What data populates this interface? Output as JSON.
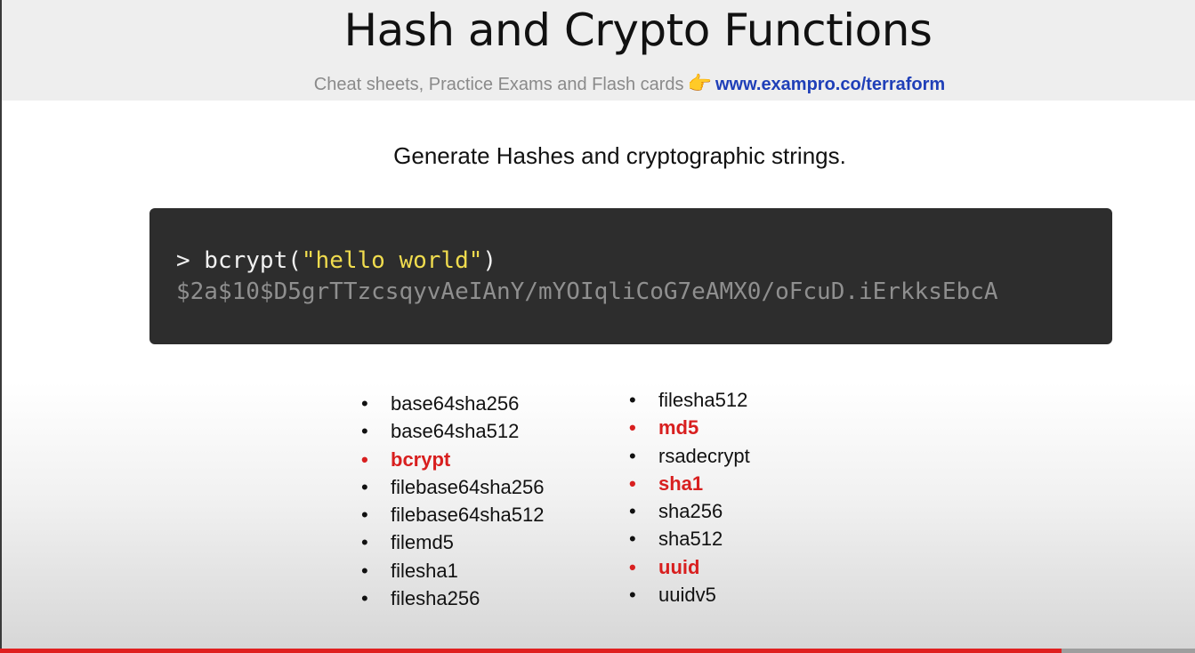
{
  "slide": {
    "title": "Hash and Crypto Functions",
    "promo_text": "Cheat sheets, Practice Exams and Flash cards",
    "promo_icon": "pointing-hand-icon",
    "promo_hand_glyph": "👉",
    "promo_link": "www.exampro.co/terraform",
    "subtitle": "Generate Hashes and cryptographic strings."
  },
  "code": {
    "prompt_prefix": "> bcrypt(",
    "prompt_arg": "\"hello world\"",
    "prompt_suffix": ")",
    "output": "$2a$10$D5grTTzcsqyvAeIAnY/mYOIqliCoG7eAMX0/oFcuD.iErkksEbcA"
  },
  "functions_left": [
    {
      "name": "base64sha256",
      "highlight": false
    },
    {
      "name": "base64sha512",
      "highlight": false
    },
    {
      "name": "bcrypt",
      "highlight": true
    },
    {
      "name": "filebase64sha256",
      "highlight": false
    },
    {
      "name": "filebase64sha512",
      "highlight": false
    },
    {
      "name": "filemd5",
      "highlight": false
    },
    {
      "name": "filesha1",
      "highlight": false
    },
    {
      "name": "filesha256",
      "highlight": false
    }
  ],
  "functions_right": [
    {
      "name": "filesha512",
      "highlight": false
    },
    {
      "name": "md5",
      "highlight": true
    },
    {
      "name": "rsadecrypt",
      "highlight": false
    },
    {
      "name": "sha1",
      "highlight": true
    },
    {
      "name": "sha256",
      "highlight": false
    },
    {
      "name": "sha512",
      "highlight": false
    },
    {
      "name": "uuid",
      "highlight": true
    },
    {
      "name": "uuidv5",
      "highlight": false
    }
  ],
  "colors": {
    "highlight": "#d81f1f",
    "link": "#1f3fb8",
    "code_bg": "#2d2d2d",
    "string": "#f0dc4e",
    "progress": "#e02020"
  },
  "video_progress": 0.888
}
